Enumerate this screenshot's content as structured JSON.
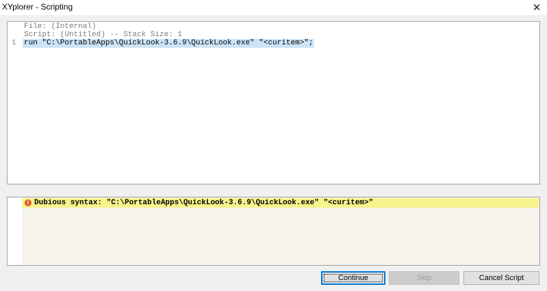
{
  "window": {
    "title": "XYplorer - Scripting",
    "close_glyph": "✕"
  },
  "script_panel": {
    "file_line": "File: (Internal)",
    "script_line": "Script: (Untitled) -- Stack Size: 1",
    "lines": [
      {
        "number": "1",
        "code": "run \"C:\\PortableApps\\QuickLook-3.6.9\\QuickLook.exe\" \"<curitem>\";"
      }
    ]
  },
  "message_panel": {
    "icon": "warning-icon",
    "text": "Dubious syntax: \"C:\\PortableApps\\QuickLook-3.6.9\\QuickLook.exe\" \"<curitem>\""
  },
  "buttons": {
    "continue": "Continue",
    "skip": "Skip",
    "cancel": "Cancel Script"
  },
  "colors": {
    "highlight": "#cce4f7",
    "message_bg": "#f7f38d",
    "accent": "#0078d7"
  }
}
